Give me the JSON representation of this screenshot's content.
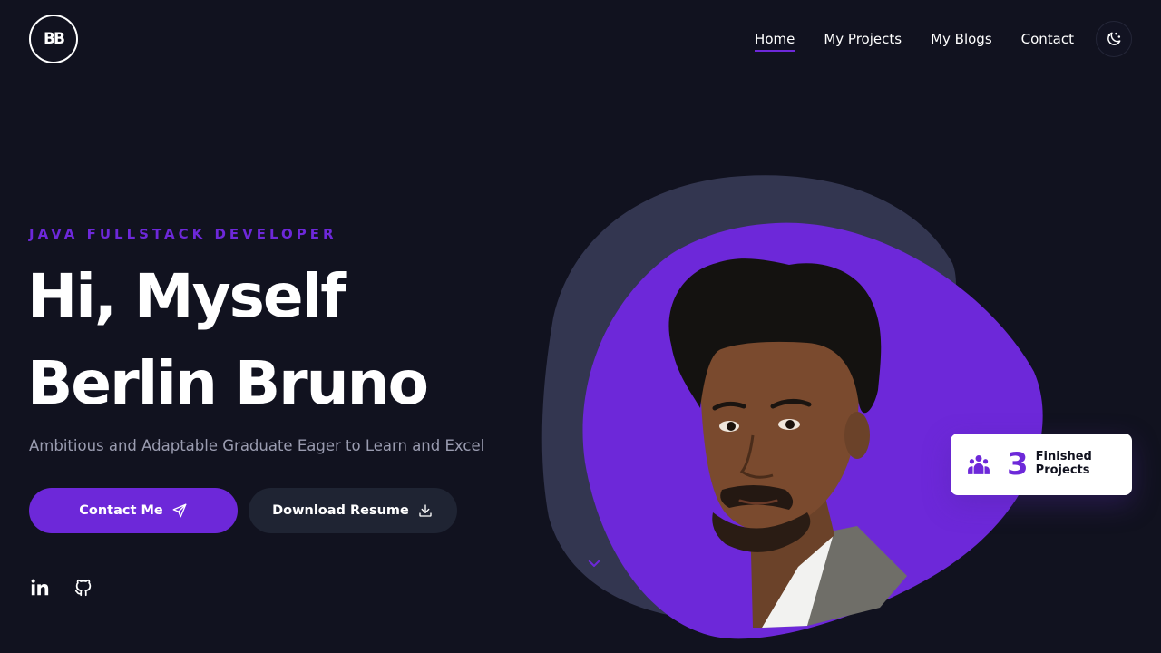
{
  "colors": {
    "background": "#11121f",
    "accent": "#6d28d9",
    "blob_back": "#333650",
    "secondary_button": "#1f2433",
    "muted_text": "#9a9cb0",
    "card": "#ffffff"
  },
  "nav": {
    "logo": "BB",
    "links": [
      {
        "label": "Home",
        "active": true
      },
      {
        "label": "My Projects",
        "active": false
      },
      {
        "label": "My Blogs",
        "active": false
      },
      {
        "label": "Contact",
        "active": false
      }
    ],
    "theme_toggle_icon": "moon-stars-icon"
  },
  "hero": {
    "eyebrow": "JAVA FULLSTACK DEVELOPER",
    "title_line1": "Hi, Myself",
    "title_line2": "Berlin Bruno",
    "subtitle": "Ambitious and Adaptable Graduate Eager to Learn and Excel",
    "primary_button": {
      "label": "Contact Me",
      "icon": "send-icon"
    },
    "secondary_button": {
      "label": "Download Resume",
      "icon": "download-icon"
    },
    "socials": [
      {
        "icon": "linkedin-icon"
      },
      {
        "icon": "github-icon"
      }
    ]
  },
  "stat_card": {
    "icon": "users-icon",
    "value": "3",
    "label_line1": "Finished",
    "label_line2": "Projects"
  },
  "scroll_hint_icon": "chevron-down-icon"
}
